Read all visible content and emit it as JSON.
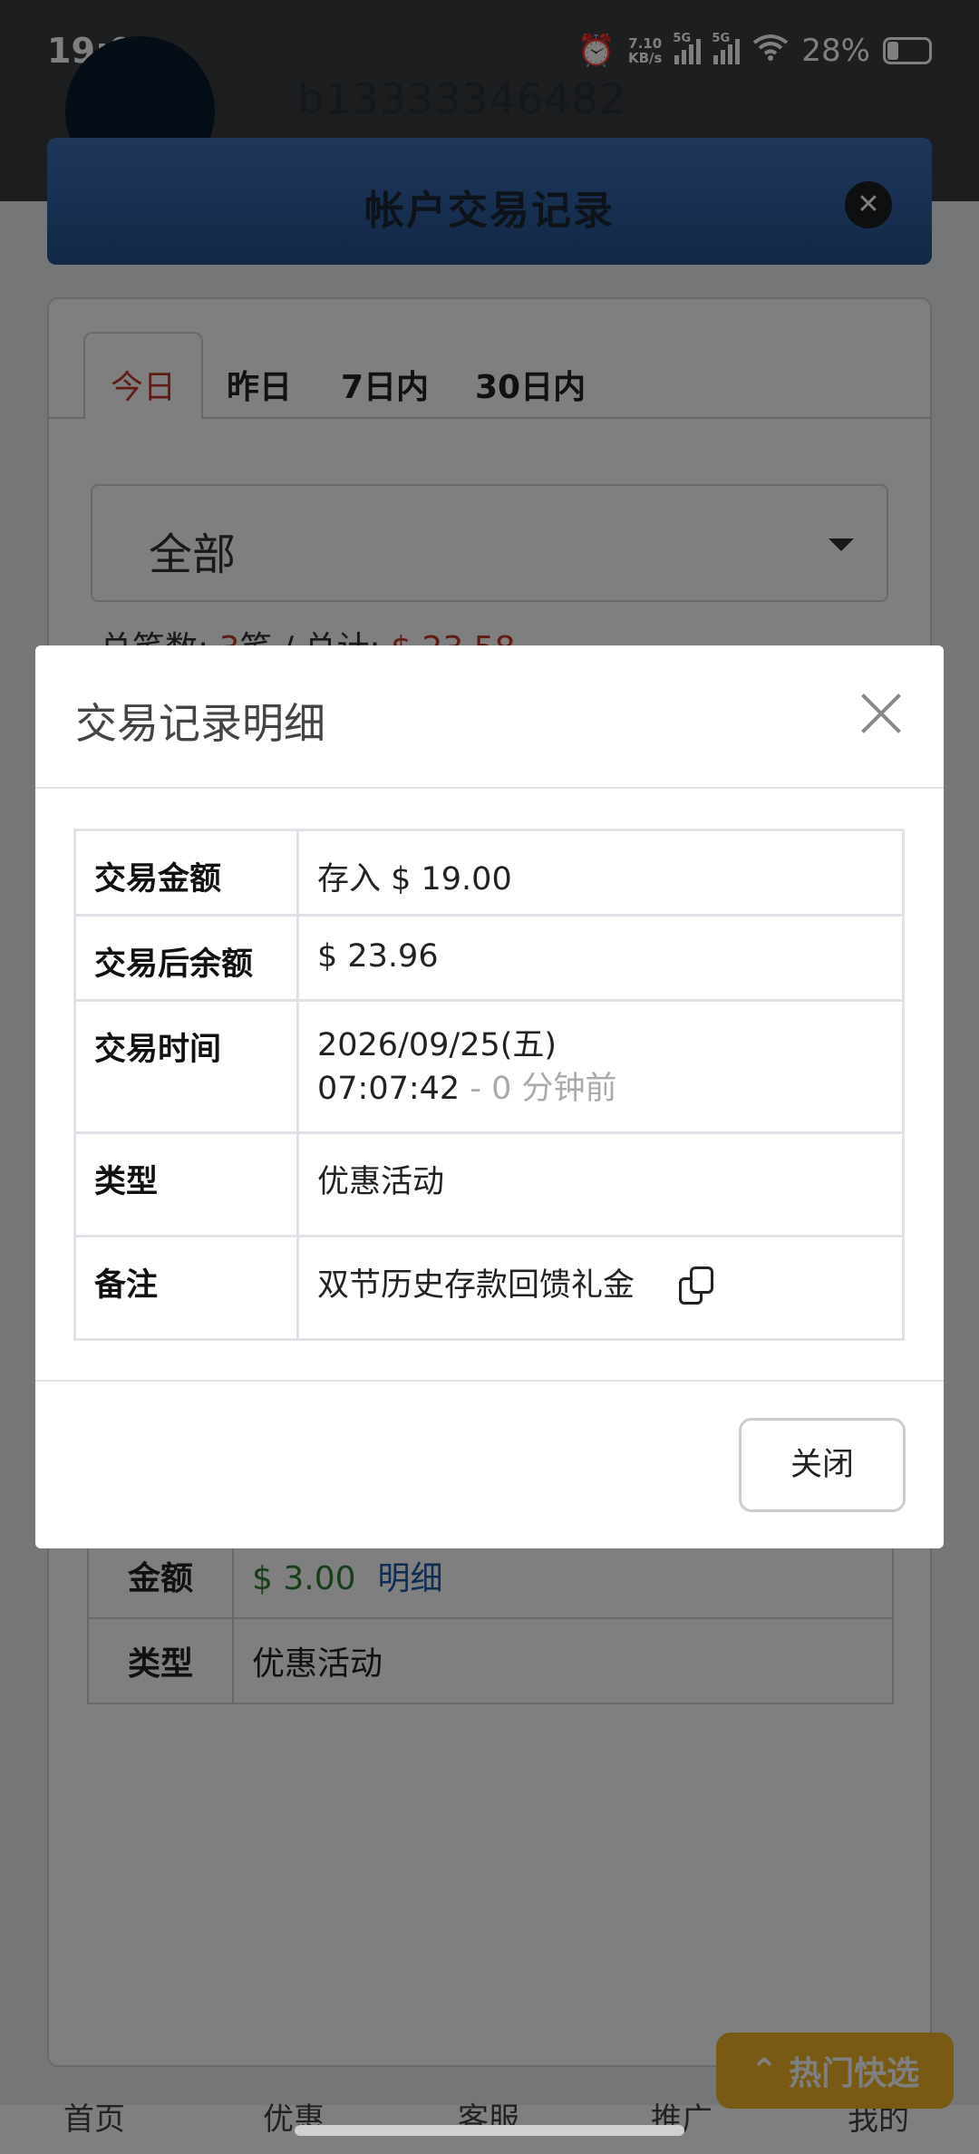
{
  "status_bar": {
    "time": "19:08",
    "net_speed_top": "7.10",
    "net_speed_bottom": "KB/s",
    "net1": "5G",
    "net2": "5G",
    "battery": "28%"
  },
  "background": {
    "username": "b13333346482",
    "modal_title": "帐户交易记录",
    "tabs": [
      "今日",
      "昨日",
      "7日内",
      "30日内"
    ],
    "filter_value": "全部",
    "summary": {
      "count_label": "总笔数: ",
      "count_value": "3",
      "count_unit": "笔 / 总计: ",
      "total_value": "$ 23.58"
    },
    "row_amount_label": "金额",
    "row_amount_value": "$ 3.00",
    "row_detail_link": "明细",
    "row_type_label": "类型",
    "row_type_value": "优惠活动",
    "hot_button": "热门快选",
    "nav": [
      "首页",
      "优惠",
      "客服",
      "推广",
      "我的"
    ]
  },
  "dialog": {
    "title": "交易记录明细",
    "rows": [
      {
        "label": "交易金额",
        "value": "存入 $ 19.00"
      },
      {
        "label": "交易后余额",
        "value": "$ 23.96"
      },
      {
        "label": "交易时间",
        "date": "2026/09/25(五)",
        "time": "07:07:42",
        "relative": " - 0 分钟前"
      },
      {
        "label": "类型",
        "value": "优惠活动"
      },
      {
        "label": "备注",
        "value": "双节历史存款回馈礼金"
      }
    ],
    "close_button": "关闭"
  },
  "colors": {
    "accent_red": "#c0392b",
    "deposit_green": "#2e7d32",
    "link_blue": "#1f5aa6",
    "header_blue": "#2f5fa3",
    "hot_button": "#f0b429"
  }
}
